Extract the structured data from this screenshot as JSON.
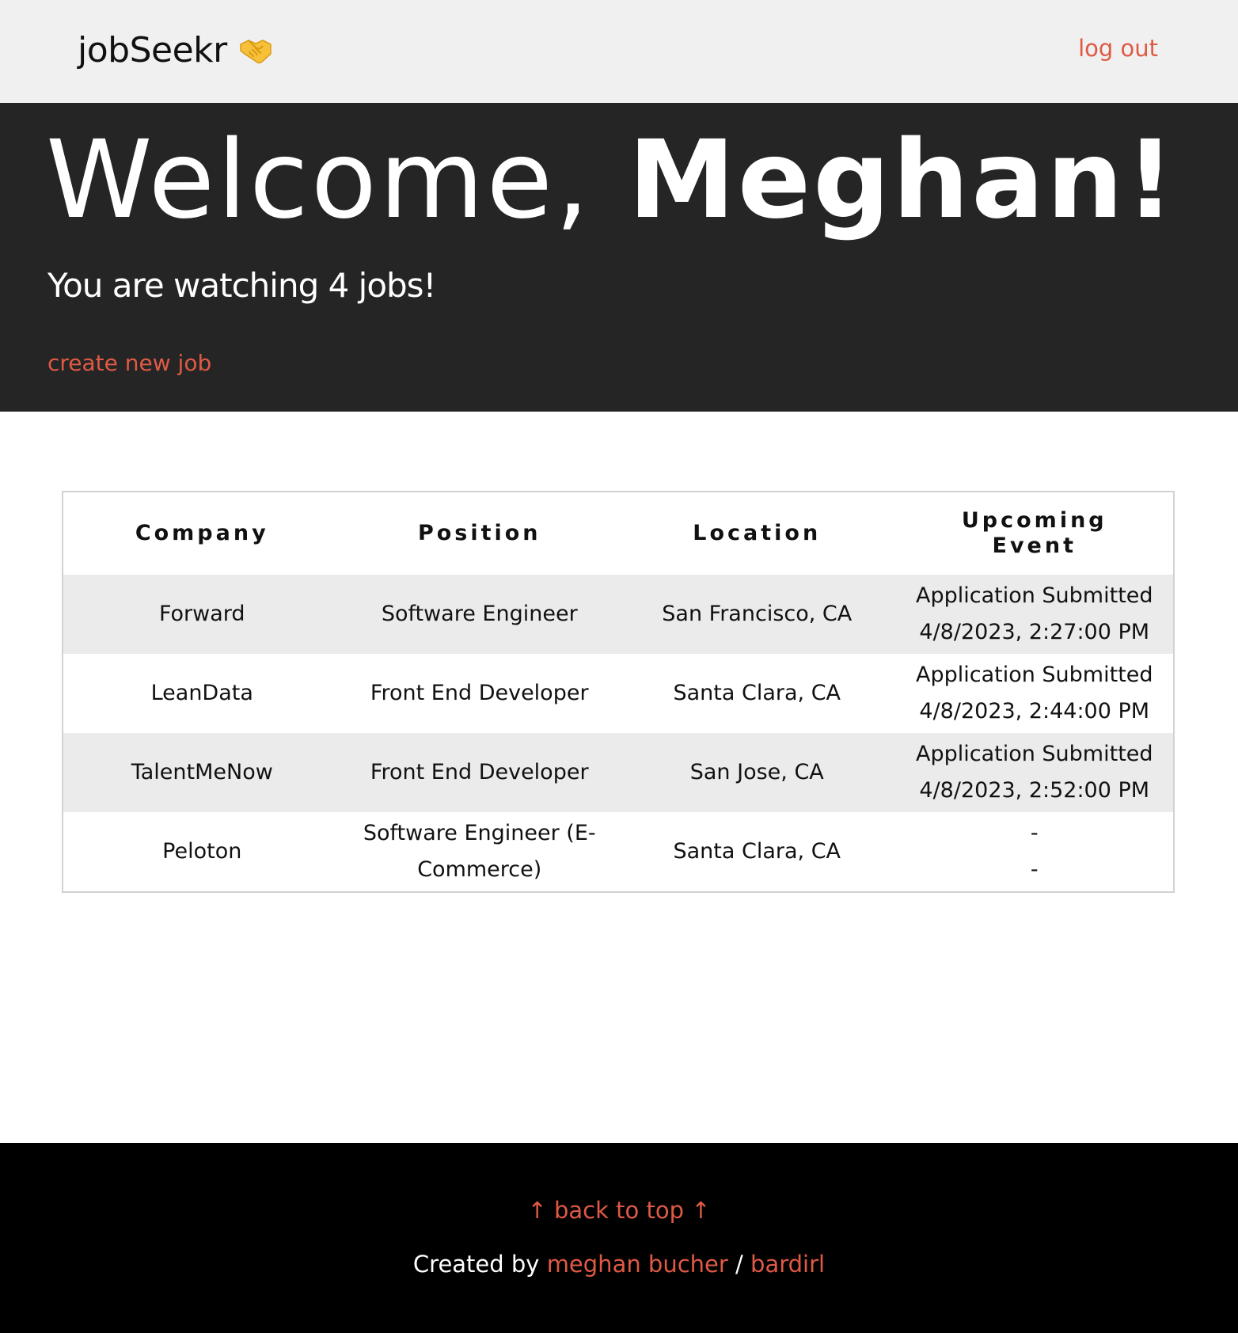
{
  "header": {
    "brand": "jobSeekr",
    "brand_icon": "handshake-icon",
    "logout_label": "log out"
  },
  "hero": {
    "welcome_prefix": "Welcome, ",
    "user_name": "Meghan!",
    "watching_text": "You are watching 4 jobs!",
    "create_label": "create new job"
  },
  "table": {
    "columns": [
      "Company",
      "Position",
      "Location",
      "Upcoming Event"
    ],
    "rows": [
      {
        "company": "Forward",
        "position": "Software Engineer",
        "location": "San Francisco, CA",
        "event": "Application Submitted",
        "event_time": "4/8/2023, 2:27:00 PM"
      },
      {
        "company": "LeanData",
        "position": "Front End Developer",
        "location": "Santa Clara, CA",
        "event": "Application Submitted",
        "event_time": "4/8/2023, 2:44:00 PM"
      },
      {
        "company": "TalentMeNow",
        "position": "Front End Developer",
        "location": "San Jose, CA",
        "event": "Application Submitted",
        "event_time": "4/8/2023, 2:52:00 PM"
      },
      {
        "company": "Peloton",
        "position": "Software Engineer (E-Commerce)",
        "location": "Santa Clara, CA",
        "event": "-",
        "event_time": "-"
      }
    ]
  },
  "footer": {
    "back_to_top": "↑ back to top ↑",
    "created_by": "Created by ",
    "author": "meghan bucher",
    "separator": " / ",
    "handle": "bardirl"
  },
  "colors": {
    "accent": "#df5a45",
    "header_bg": "#f0f0f0",
    "hero_bg": "#252525",
    "footer_bg": "#000000",
    "row_alt": "#ebebeb"
  }
}
